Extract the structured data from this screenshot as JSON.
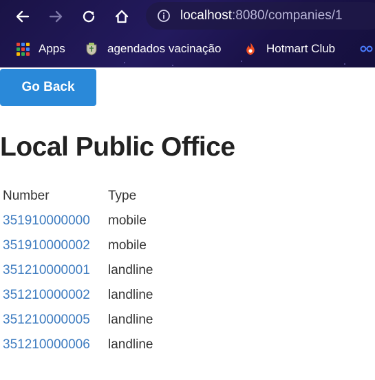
{
  "browser": {
    "url_host": "localhost",
    "url_rest": ":8080/companies/1",
    "bookmarks": [
      {
        "label": "Apps",
        "icon": "apps-grid-icon"
      },
      {
        "label": "agendados vacinação",
        "icon": "vaccine-crest-icon"
      },
      {
        "label": "Hotmart Club",
        "icon": "hotmart-flame-icon"
      }
    ],
    "colors": {
      "chrome_bg": "#1f1852",
      "accent_flame": "#f04e23"
    }
  },
  "page": {
    "go_back_label": "Go Back",
    "title": "Local Public Office",
    "table": {
      "headers": [
        "Number",
        "Type"
      ],
      "rows": [
        {
          "number": "351910000000",
          "type": "mobile"
        },
        {
          "number": "351910000002",
          "type": "mobile"
        },
        {
          "number": "351210000001",
          "type": "landline"
        },
        {
          "number": "351210000002",
          "type": "landline"
        },
        {
          "number": "351210000005",
          "type": "landline"
        },
        {
          "number": "351210000006",
          "type": "landline"
        }
      ]
    },
    "colors": {
      "button": "#2a89d9",
      "link": "#3e7cc0",
      "text": "#222222"
    }
  }
}
